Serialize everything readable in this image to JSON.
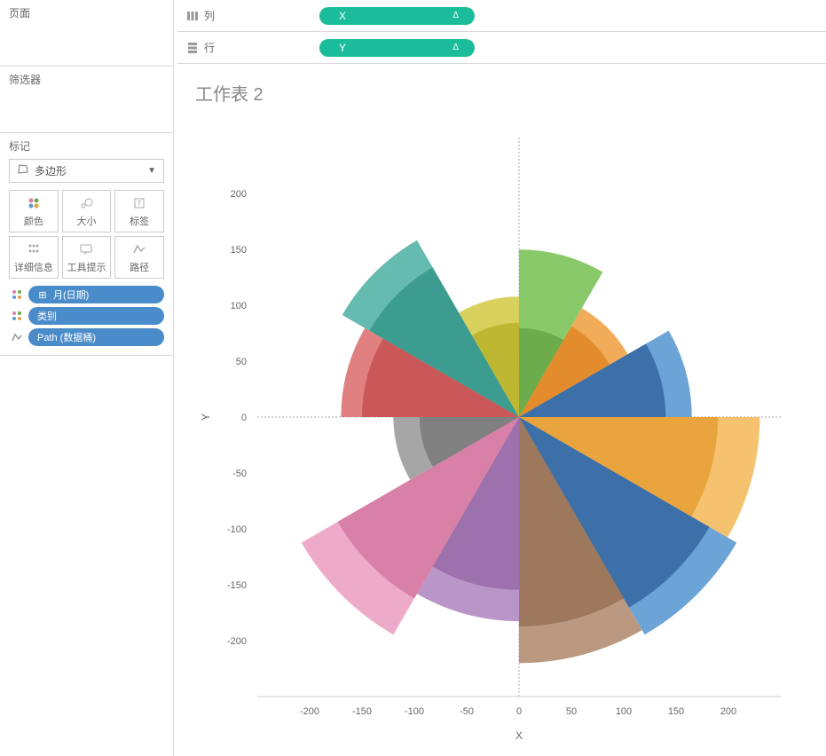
{
  "shelves": {
    "columns": {
      "label": "列",
      "pill": "X",
      "delta": "Δ"
    },
    "rows": {
      "label": "行",
      "pill": "Y",
      "delta": "Δ"
    }
  },
  "left": {
    "pages": "页面",
    "filters": "筛选器",
    "marks": "标记",
    "mark_type": "多边形",
    "buttons": {
      "color": "颜色",
      "size": "大小",
      "label": "标签",
      "detail": "详细信息",
      "tooltip": "工具提示",
      "path": "路径"
    },
    "fields": [
      {
        "label": "月(日期)",
        "icon": "plus"
      },
      {
        "label": "类别",
        "icon": "none"
      },
      {
        "label": "Path (数据桶)",
        "icon": "none"
      }
    ]
  },
  "viz": {
    "title": "工作表 2",
    "xlabel": "X",
    "ylabel": "Y"
  },
  "chart_data": {
    "type": "other",
    "description": "Nightingale rose / coxcomb chart on X-Y Cartesian axes",
    "xlim": [
      -250,
      250
    ],
    "ylim": [
      -250,
      250
    ],
    "x_ticks": [
      -200,
      -150,
      -100,
      -50,
      0,
      50,
      100,
      150,
      200
    ],
    "y_ticks": [
      -200,
      -150,
      -100,
      -50,
      0,
      50,
      100,
      150,
      200
    ],
    "xlabel": "X",
    "ylabel": "Y",
    "wedges": [
      {
        "angle_start": 60,
        "angle_end": 90,
        "inner": 85,
        "outer": 160,
        "color": "#6aab4a",
        "color_outer": "#7cc35a"
      },
      {
        "angle_start": 30,
        "angle_end": 60,
        "inner": 100,
        "outer": 120,
        "color": "#e28a2b",
        "color_outer": "#f0a347"
      },
      {
        "angle_start": 0,
        "angle_end": 30,
        "inner": 140,
        "outer": 165,
        "color": "#3b6ea5",
        "color_outer": "#5d9ad4"
      },
      {
        "angle_start": -30,
        "angle_end": 0,
        "inner": 190,
        "outer": 230,
        "color": "#e9a23b",
        "color_outer": "#f4bb5f"
      },
      {
        "angle_start": -60,
        "angle_end": -30,
        "inner": 210,
        "outer": 240,
        "color": "#3b6ea5",
        "color_outer": "#5d9ad4"
      },
      {
        "angle_start": -90,
        "angle_end": -60,
        "inner": 200,
        "outer": 235,
        "color": "#9b765a",
        "color_outer": "#b38e72"
      },
      {
        "angle_start": -120,
        "angle_end": -90,
        "inner": 165,
        "outer": 195,
        "color": "#9a6fab",
        "color_outer": "#b38ac2"
      },
      {
        "angle_start": -150,
        "angle_end": -120,
        "inner": 200,
        "outer": 240,
        "color": "#d87da6",
        "color_outer": "#eba2c3"
      },
      {
        "angle_start": -180,
        "angle_end": -150,
        "inner": 95,
        "outer": 120,
        "color": "#7d7d7d",
        "color_outer": "#9c9c9c"
      },
      {
        "angle_start": 150,
        "angle_end": 180,
        "inner": 150,
        "outer": 170,
        "color": "#c95555",
        "color_outer": "#dd7272"
      },
      {
        "angle_start": 120,
        "angle_end": 150,
        "inner": 165,
        "outer": 195,
        "color": "#3b9a8e",
        "color_outer": "#54b4a6"
      },
      {
        "angle_start": 90,
        "angle_end": 120,
        "inner": 90,
        "outer": 115,
        "color": "#bdb52f",
        "color_outer": "#d4cc4c"
      }
    ]
  }
}
